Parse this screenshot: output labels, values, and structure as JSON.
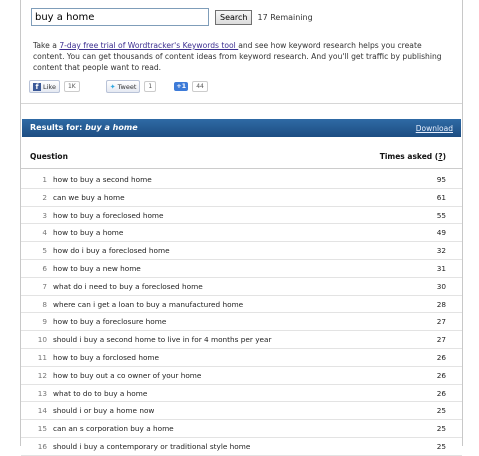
{
  "search": {
    "value": "buy a home",
    "button_label": "Search",
    "remaining": "17 Remaining"
  },
  "promo": {
    "prefix": "Take a ",
    "link": "7-day free trial of Wordtracker's Keywords tool ",
    "suffix": "and see how keyword research helps you create content. You can get thousands of content ideas from keyword research. And you'll get traffic by publishing content that people want to read."
  },
  "social": {
    "like_label": "Like",
    "like_count": "1K",
    "tweet_label": "Tweet",
    "tweet_count": "1",
    "plusone_label": "+1",
    "plusone_count": "44"
  },
  "results": {
    "title_prefix": "Results for: ",
    "query": "buy a home",
    "download_label": "Download",
    "col_question": "Question",
    "col_times_prefix": "Times asked (",
    "col_times_help": "?",
    "col_times_suffix": ")",
    "rows": [
      {
        "num": "1",
        "question": "how to buy a second home",
        "times": "95"
      },
      {
        "num": "2",
        "question": "can we buy a home",
        "times": "61"
      },
      {
        "num": "3",
        "question": "how to buy a foreclosed home",
        "times": "55"
      },
      {
        "num": "4",
        "question": "how to buy a home",
        "times": "49"
      },
      {
        "num": "5",
        "question": "how do i buy a foreclosed home",
        "times": "32"
      },
      {
        "num": "6",
        "question": "how to buy a new home",
        "times": "31"
      },
      {
        "num": "7",
        "question": "what do i need to buy a foreclosed home",
        "times": "30"
      },
      {
        "num": "8",
        "question": "where can i get a loan to buy a manufactured home",
        "times": "28"
      },
      {
        "num": "9",
        "question": "how to buy a foreclosure home",
        "times": "27"
      },
      {
        "num": "10",
        "question": "should i buy a second home to live in for 4 months per year",
        "times": "27"
      },
      {
        "num": "11",
        "question": "how to buy a forclosed home",
        "times": "26"
      },
      {
        "num": "12",
        "question": "how to buy out a co owner of your home",
        "times": "26"
      },
      {
        "num": "13",
        "question": "what to do to buy a home",
        "times": "26"
      },
      {
        "num": "14",
        "question": "should i or buy a home now",
        "times": "25"
      },
      {
        "num": "15",
        "question": "can an s corporation buy a home",
        "times": "25"
      },
      {
        "num": "16",
        "question": "should i buy a contemporary or traditional style home",
        "times": "25"
      }
    ]
  }
}
